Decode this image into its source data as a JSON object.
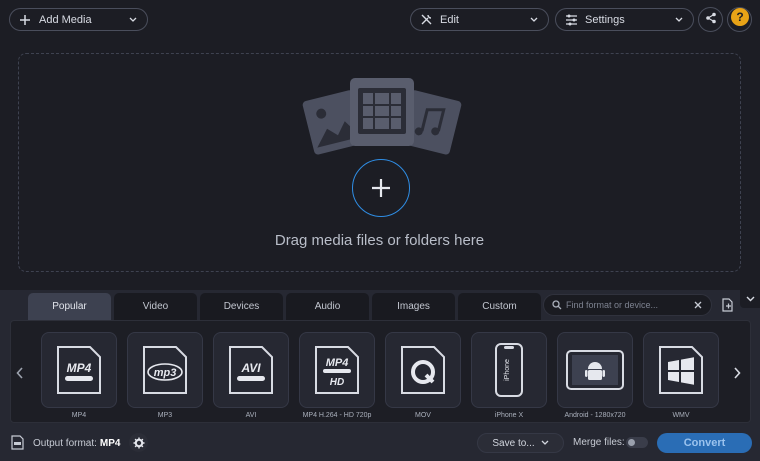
{
  "toolbar": {
    "add_media": "Add Media",
    "edit": "Edit",
    "settings": "Settings"
  },
  "dropzone": {
    "text": "Drag media files or folders here"
  },
  "tabs": [
    "Popular",
    "Video",
    "Devices",
    "Audio",
    "Images",
    "Custom"
  ],
  "active_tab": "Popular",
  "search": {
    "placeholder": "Find format or device..."
  },
  "formats": [
    {
      "label": "MP4",
      "icon": "mp4-icon"
    },
    {
      "label": "MP3",
      "icon": "mp3-icon"
    },
    {
      "label": "AVI",
      "icon": "avi-icon"
    },
    {
      "label": "MP4 H.264 - HD 720p",
      "icon": "mp4-hd-icon"
    },
    {
      "label": "MOV",
      "icon": "quicktime-icon"
    },
    {
      "label": "iPhone X",
      "icon": "iphone-icon"
    },
    {
      "label": "Android - 1280x720",
      "icon": "android-tablet-icon"
    },
    {
      "label": "WMV",
      "icon": "windows-icon"
    }
  ],
  "format_logos": {
    "mp4": "MP4",
    "mp3": "mp3",
    "avi": "AVI",
    "mp4hd_top": "MP4",
    "mp4hd_bottom": "HD",
    "iphone": "iPhone"
  },
  "footer": {
    "output_label": "Output format:",
    "output_value": "MP4",
    "save_to": "Save to...",
    "merge_files": "Merge files:",
    "convert": "Convert"
  },
  "colors": {
    "accent": "#2f8de4",
    "convert_bg": "#2a6db5",
    "background": "#1c1d24",
    "panel": "#262832"
  }
}
